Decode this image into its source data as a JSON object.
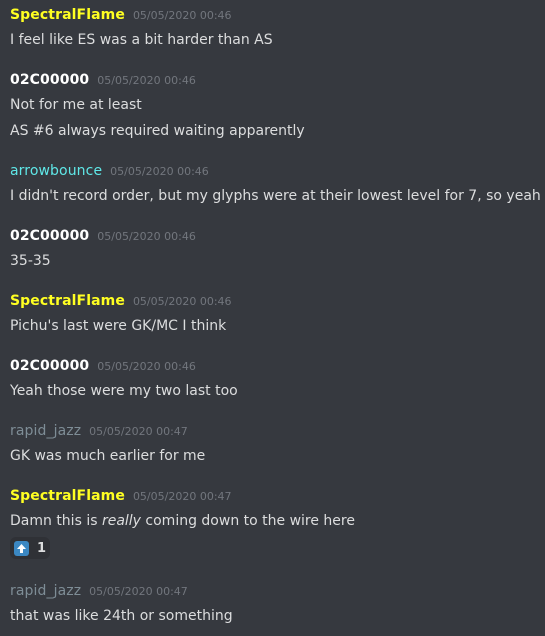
{
  "colors": {
    "background": "#36393f",
    "spectral": "#ffff22",
    "oc": "#ffffff",
    "arrow": "#5fe8e8",
    "rapid": "#7e8d96",
    "timestamp": "#72767d",
    "text": "#dcddde"
  },
  "messages": [
    {
      "author": "SpectralFlame",
      "timestamp": "05/05/2020 00:46",
      "lines": [
        "I feel like ES was a bit harder than AS"
      ]
    },
    {
      "author": "02C00000",
      "timestamp": "05/05/2020 00:46",
      "lines": [
        "Not for me at least",
        "AS #6 always required waiting apparently"
      ]
    },
    {
      "author": "arrowbounce",
      "timestamp": "05/05/2020 00:46",
      "lines": [
        "I didn't record order, but my glyphs were at their lowest level for 7, so yeah"
      ]
    },
    {
      "author": "02C00000",
      "timestamp": "05/05/2020 00:46",
      "lines": [
        "35-35"
      ]
    },
    {
      "author": "SpectralFlame",
      "timestamp": "05/05/2020 00:46",
      "lines": [
        "Pichu's last were GK/MC I think"
      ]
    },
    {
      "author": "02C00000",
      "timestamp": "05/05/2020 00:46",
      "lines": [
        "Yeah those were my two last too"
      ]
    },
    {
      "author": "rapid_jazz",
      "timestamp": "05/05/2020 00:47",
      "lines": [
        "GK was much earlier for me"
      ]
    },
    {
      "author": "SpectralFlame",
      "timestamp": "05/05/2020 00:47",
      "line_before": "Damn this is ",
      "line_emph": "really",
      "line_after": " coming down to the wire here",
      "reaction": {
        "icon": "up-arrow-emoji-icon",
        "count": "1"
      }
    },
    {
      "author": "rapid_jazz",
      "timestamp": "05/05/2020 00:47",
      "lines": [
        "that was like 24th or something"
      ]
    }
  ]
}
